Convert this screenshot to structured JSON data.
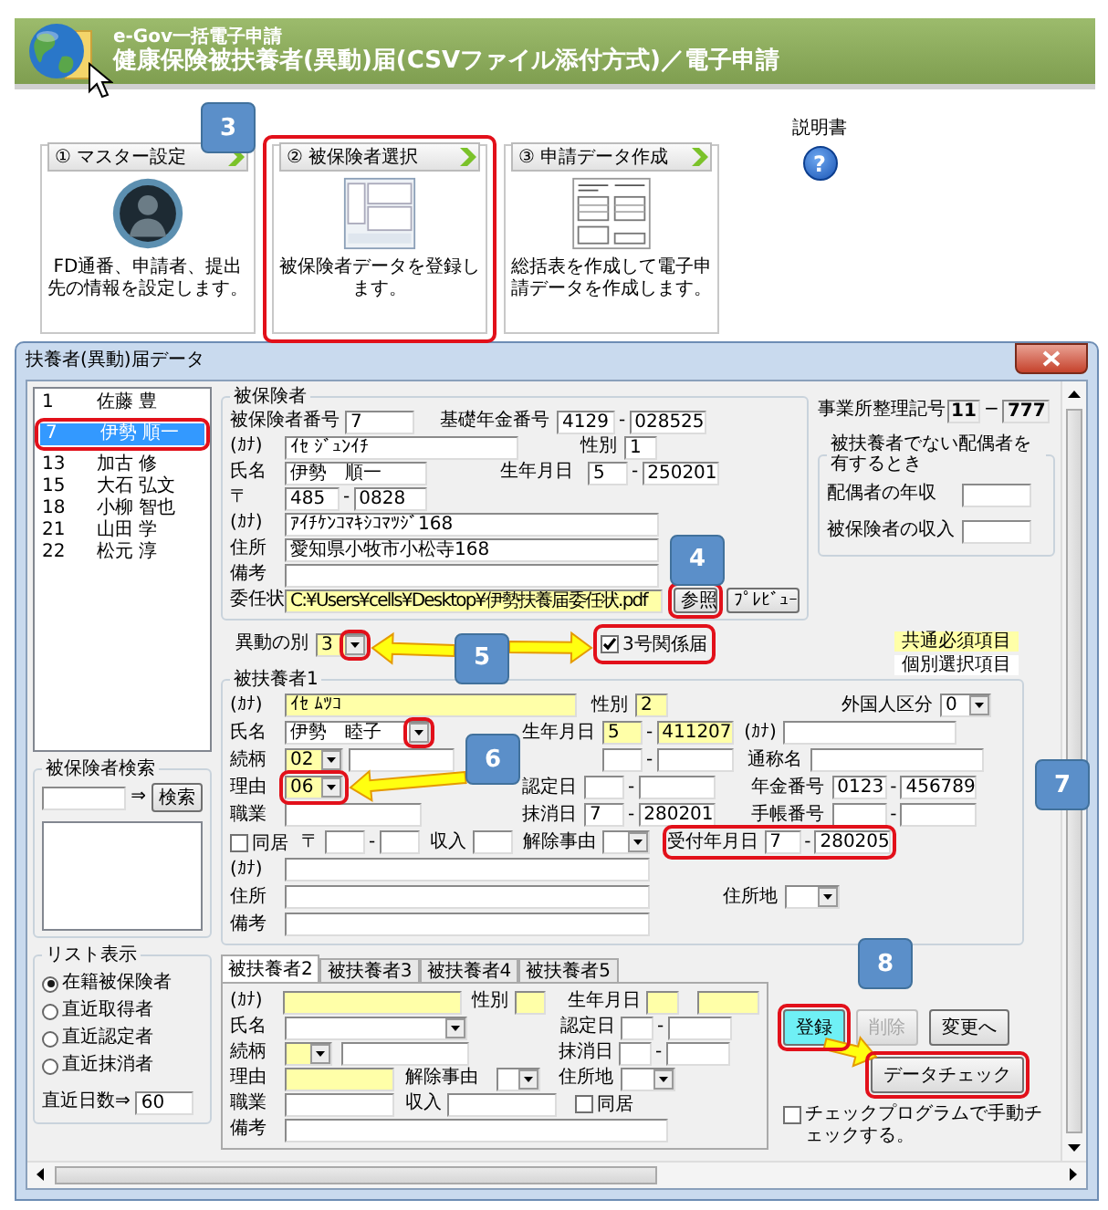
{
  "header": {
    "subtitle": "e-Gov一括電子申請",
    "title": "健康保険被扶養者(異動)届(CSVファイル添付方式)／電子申請"
  },
  "steps": [
    {
      "number": "①",
      "label": "マスター設定",
      "description": "FD通番、申請者、提出先の情報を設定します。",
      "kind": "avatar"
    },
    {
      "number": "②",
      "label": "被保険者選択",
      "description": "被保険者データを登録します。",
      "kind": "form"
    },
    {
      "number": "③",
      "label": "申請データ作成",
      "description": "総括表を作成して電子申請データを作成します。",
      "kind": "document"
    }
  ],
  "help": {
    "label": "説明書",
    "icon": "?"
  },
  "window": {
    "title": "扶養者(異動)届データ"
  },
  "insured_list": [
    {
      "number": "1",
      "name": "佐藤 豊",
      "selected": false
    },
    {
      "number": "7",
      "name": "伊勢 順一",
      "selected": true
    },
    {
      "number": "13",
      "name": "加古 修",
      "selected": false
    },
    {
      "number": "15",
      "name": "大石 弘文",
      "selected": false
    },
    {
      "number": "18",
      "name": "小柳 智也",
      "selected": false
    },
    {
      "number": "21",
      "name": "山田 学",
      "selected": false
    },
    {
      "number": "22",
      "name": "松元 淳",
      "selected": false
    }
  ],
  "search": {
    "title": "被保険者検索",
    "arrow": "⇒",
    "button": "検索"
  },
  "list_view": {
    "title": "リスト表示",
    "options": [
      {
        "label": "在籍被保険者",
        "selected": true
      },
      {
        "label": "直近取得者",
        "selected": false
      },
      {
        "label": "直近認定者",
        "selected": false
      },
      {
        "label": "直近抹消者",
        "selected": false
      }
    ],
    "days_label": "直近日数⇒",
    "days_value": "60"
  },
  "insured": {
    "title": "被保険者",
    "lines": [
      {
        "items": [
          {
            "kind": "label",
            "text": "被保険者番号"
          },
          {
            "kind": "field",
            "value": "7"
          },
          {
            "kind": "label",
            "text": "基礎年金番号"
          },
          {
            "kind": "field",
            "value": "4129"
          },
          {
            "kind": "sep",
            "text": "-"
          },
          {
            "kind": "field",
            "value": "028525"
          }
        ]
      },
      {
        "items": [
          {
            "kind": "label",
            "text": "(ｶﾅ)"
          },
          {
            "kind": "field",
            "value": "ｲｾ ｼﾞｭﾝｲﾁ"
          },
          {
            "kind": "label",
            "text": "性別"
          },
          {
            "kind": "field",
            "value": "1"
          }
        ]
      },
      {
        "items": [
          {
            "kind": "label",
            "text": "氏名"
          },
          {
            "kind": "field",
            "value": "伊勢　順一"
          },
          {
            "kind": "label",
            "text": "生年月日"
          },
          {
            "kind": "field",
            "value": "5"
          },
          {
            "kind": "sep",
            "text": "-"
          },
          {
            "kind": "field",
            "value": "250201"
          }
        ]
      },
      {
        "items": [
          {
            "kind": "label",
            "text": "〒"
          },
          {
            "kind": "field",
            "value": "485"
          },
          {
            "kind": "sep",
            "text": "-"
          },
          {
            "kind": "field",
            "value": "0828"
          }
        ]
      },
      {
        "items": [
          {
            "kind": "label",
            "text": "(ｶﾅ)"
          },
          {
            "kind": "field",
            "value": "ｱｲﾁｹﾝｺﾏｷｼｺﾏﾂｼﾞ168"
          }
        ]
      },
      {
        "items": [
          {
            "kind": "label",
            "text": "住所"
          },
          {
            "kind": "field",
            "value": "愛知県小牧市小松寺168"
          }
        ]
      },
      {
        "items": [
          {
            "kind": "label",
            "text": "備考"
          },
          {
            "kind": "field"
          }
        ]
      },
      {
        "items": [
          {
            "kind": "label",
            "text": "委任状"
          },
          {
            "kind": "field",
            "value": "C:¥Users¥cells¥Desktop¥伊勢扶養届委任状.pdf",
            "required": true
          },
          {
            "kind": "button",
            "text": "参照"
          },
          {
            "kind": "button",
            "text": "ﾌﾟﾚﾋﾞｭｰ"
          }
        ]
      }
    ]
  },
  "office": [
    {
      "kind": "label",
      "text": "事業所整理記号"
    },
    {
      "kind": "display",
      "value": "11"
    },
    {
      "kind": "sep",
      "text": "−"
    },
    {
      "kind": "display",
      "value": "777"
    }
  ],
  "spouse": {
    "title": "被扶養者でない配偶者を有するとき",
    "lines": [
      {
        "items": [
          {
            "kind": "label",
            "text": "配偶者の年収"
          },
          {
            "kind": "field"
          }
        ]
      },
      {
        "items": [
          {
            "kind": "label",
            "text": "被保険者の収入"
          },
          {
            "kind": "field"
          }
        ]
      }
    ]
  },
  "change_row": [
    {
      "kind": "label",
      "text": "異動の別"
    },
    {
      "kind": "select",
      "value": "3",
      "required": true
    },
    {
      "kind": "check",
      "text": "3号関係届",
      "checked": true
    }
  ],
  "legend": [
    {
      "text": "共通必須項目",
      "required": true
    },
    {
      "text": "個別選択項目",
      "required": false
    }
  ],
  "dependent1": {
    "title": "被扶養者1",
    "lines": [
      {
        "items": [
          {
            "kind": "label",
            "text": "(ｶﾅ)"
          },
          {
            "kind": "field",
            "value": "ｲｾ ﾑﾂｺ",
            "required": true
          },
          {
            "kind": "label",
            "text": "性別"
          },
          {
            "kind": "field",
            "value": "2",
            "required": true
          },
          {
            "kind": "label",
            "text": "外国人区分"
          },
          {
            "kind": "select",
            "value": "0"
          }
        ]
      },
      {
        "items": [
          {
            "kind": "label",
            "text": "氏名"
          },
          {
            "kind": "select",
            "value": "伊勢　睦子"
          },
          {
            "kind": "label",
            "text": "生年月日"
          },
          {
            "kind": "field",
            "value": "5",
            "required": true
          },
          {
            "kind": "sep",
            "text": "-"
          },
          {
            "kind": "field",
            "value": "411207",
            "required": true
          },
          {
            "kind": "label",
            "text": "(ｶﾅ)"
          },
          {
            "kind": "field"
          }
        ]
      },
      {
        "items": [
          {
            "kind": "label",
            "text": "続柄"
          },
          {
            "kind": "select",
            "value": "02",
            "required": true
          },
          {
            "kind": "field"
          },
          {
            "kind": "field"
          },
          {
            "kind": "sep",
            "text": "-"
          },
          {
            "kind": "field"
          },
          {
            "kind": "label",
            "text": "通称名"
          },
          {
            "kind": "field"
          }
        ]
      },
      {
        "items": [
          {
            "kind": "label",
            "text": "理由"
          },
          {
            "kind": "select",
            "value": "06",
            "required": true
          },
          {
            "kind": "label",
            "text": "認定日"
          },
          {
            "kind": "field"
          },
          {
            "kind": "sep",
            "text": "-"
          },
          {
            "kind": "field"
          },
          {
            "kind": "label",
            "text": "年金番号"
          },
          {
            "kind": "field",
            "value": "0123"
          },
          {
            "kind": "sep",
            "text": "-"
          },
          {
            "kind": "field",
            "value": "456789"
          }
        ]
      },
      {
        "items": [
          {
            "kind": "label",
            "text": "職業"
          },
          {
            "kind": "field"
          },
          {
            "kind": "label",
            "text": "抹消日"
          },
          {
            "kind": "field",
            "value": "7"
          },
          {
            "kind": "sep",
            "text": "-"
          },
          {
            "kind": "field",
            "value": "280201"
          },
          {
            "kind": "label",
            "text": "手帳番号"
          },
          {
            "kind": "field"
          },
          {
            "kind": "sep",
            "text": "-"
          },
          {
            "kind": "field"
          }
        ]
      },
      {
        "items": [
          {
            "kind": "check",
            "text": "同居",
            "checked": false
          },
          {
            "kind": "label",
            "text": "〒"
          },
          {
            "kind": "field"
          },
          {
            "kind": "sep",
            "text": "-"
          },
          {
            "kind": "field"
          },
          {
            "kind": "label",
            "text": "収入"
          },
          {
            "kind": "field"
          },
          {
            "kind": "label",
            "text": "解除事由"
          },
          {
            "kind": "select"
          },
          {
            "kind": "label",
            "text": "受付年月日"
          },
          {
            "kind": "field",
            "value": "7"
          },
          {
            "kind": "sep",
            "text": "-"
          },
          {
            "kind": "field",
            "value": "280205"
          }
        ]
      },
      {
        "items": [
          {
            "kind": "label",
            "text": "(ｶﾅ)"
          },
          {
            "kind": "field"
          }
        ]
      },
      {
        "items": [
          {
            "kind": "label",
            "text": "住所"
          },
          {
            "kind": "field"
          },
          {
            "kind": "label",
            "text": "住所地"
          },
          {
            "kind": "select"
          }
        ]
      },
      {
        "items": [
          {
            "kind": "label",
            "text": "備考"
          },
          {
            "kind": "field"
          }
        ]
      }
    ]
  },
  "tabs": [
    {
      "label": "被扶養者2",
      "selected": true
    },
    {
      "label": "被扶養者3",
      "selected": false
    },
    {
      "label": "被扶養者4",
      "selected": false
    },
    {
      "label": "被扶養者5",
      "selected": false
    }
  ],
  "dependent2": {
    "lines": [
      {
        "items": [
          {
            "kind": "label",
            "text": "(ｶﾅ)"
          },
          {
            "kind": "field",
            "required": true
          },
          {
            "kind": "label",
            "text": "性別"
          },
          {
            "kind": "field",
            "required": true
          },
          {
            "kind": "label",
            "text": "生年月日"
          },
          {
            "kind": "field",
            "required": true
          },
          {
            "kind": "field",
            "required": true
          }
        ]
      },
      {
        "items": [
          {
            "kind": "label",
            "text": "氏名"
          },
          {
            "kind": "select"
          },
          {
            "kind": "label",
            "text": "認定日"
          },
          {
            "kind": "field"
          },
          {
            "kind": "sep",
            "text": "-"
          },
          {
            "kind": "field"
          }
        ]
      },
      {
        "items": [
          {
            "kind": "label",
            "text": "続柄"
          },
          {
            "kind": "select",
            "required": true
          },
          {
            "kind": "field"
          },
          {
            "kind": "label",
            "text": "抹消日"
          },
          {
            "kind": "field"
          },
          {
            "kind": "sep",
            "text": "-"
          },
          {
            "kind": "field"
          }
        ]
      },
      {
        "items": [
          {
            "kind": "label",
            "text": "理由"
          },
          {
            "kind": "field",
            "required": true
          },
          {
            "kind": "label",
            "text": "解除事由"
          },
          {
            "kind": "select"
          },
          {
            "kind": "label",
            "text": "住所地"
          },
          {
            "kind": "select"
          }
        ]
      },
      {
        "items": [
          {
            "kind": "label",
            "text": "職業"
          },
          {
            "kind": "field"
          },
          {
            "kind": "label",
            "text": "収入"
          },
          {
            "kind": "field"
          },
          {
            "kind": "check",
            "text": "同居",
            "checked": false
          }
        ]
      },
      {
        "items": [
          {
            "kind": "label",
            "text": "備考"
          },
          {
            "kind": "field"
          }
        ]
      }
    ]
  },
  "actions": [
    {
      "label": "登録",
      "highlighted": true,
      "disabled": false
    },
    {
      "label": "削除",
      "highlighted": false,
      "disabled": true
    },
    {
      "label": "変更へ",
      "highlighted": false,
      "disabled": false
    }
  ],
  "data_check": "データチェック",
  "manual_check": {
    "label": "チェックプログラムで手動チェックする。",
    "checked": false
  },
  "callouts": [
    "3",
    "4",
    "5",
    "6",
    "7",
    "8"
  ]
}
